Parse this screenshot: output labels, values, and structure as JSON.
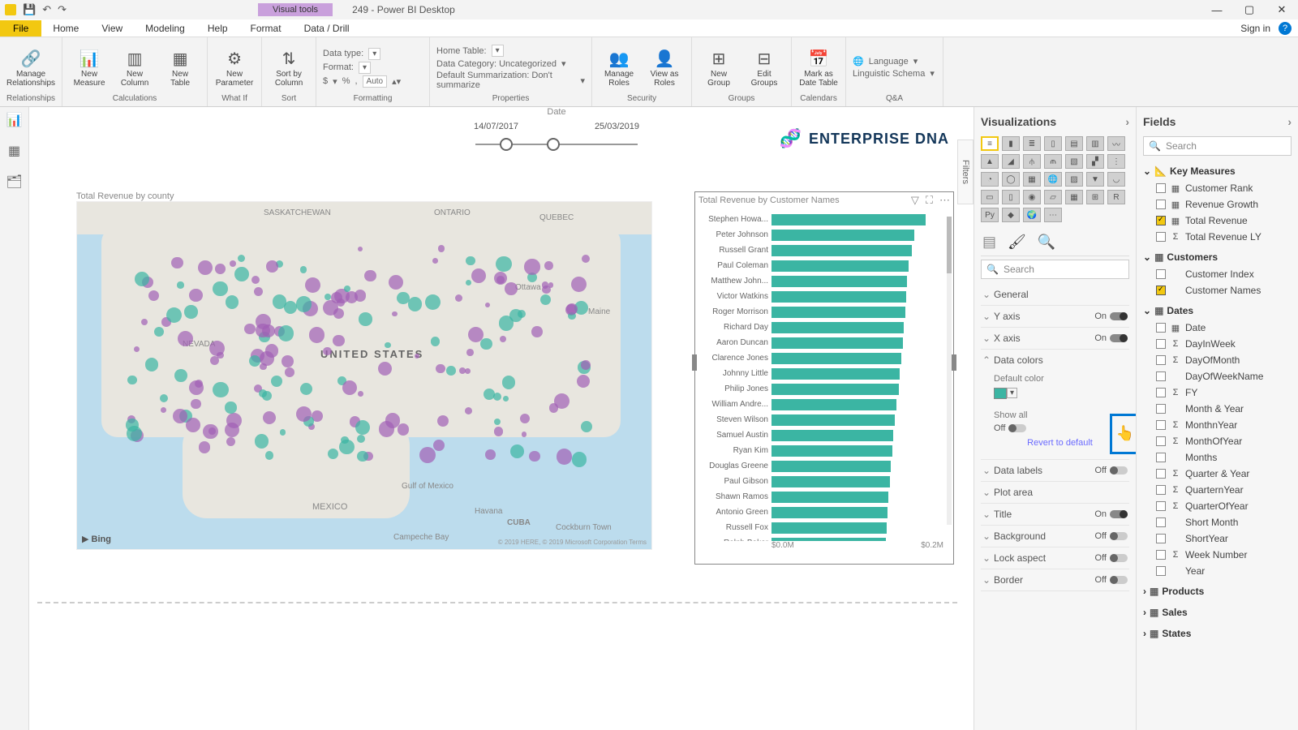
{
  "app": {
    "title": "249 - Power BI Desktop",
    "visual_tools": "Visual tools",
    "sign_in": "Sign in"
  },
  "tabs": {
    "file": "File",
    "home": "Home",
    "view": "View",
    "modeling": "Modeling",
    "help": "Help",
    "format": "Format",
    "datadrill": "Data / Drill"
  },
  "ribbon": {
    "relationships": {
      "manage": "Manage\nRelationships",
      "group": "Relationships"
    },
    "calc": {
      "measure": "New\nMeasure",
      "column": "New\nColumn",
      "table": "New\nTable",
      "group": "Calculations"
    },
    "whatif": {
      "param": "New\nParameter",
      "group": "What If"
    },
    "sort": {
      "sort": "Sort by\nColumn",
      "group": "Sort"
    },
    "formatting": {
      "datatype": "Data type:",
      "format": "Format:",
      "currency": "$",
      "percent": "%",
      "comma": ",",
      "auto": "Auto",
      "group": "Formatting"
    },
    "properties": {
      "hometable": "Home Table:",
      "datacat": "Data Category: Uncategorized",
      "defsum": "Default Summarization: Don't summarize",
      "group": "Properties"
    },
    "security": {
      "manage": "Manage\nRoles",
      "viewas": "View as\nRoles",
      "group": "Security"
    },
    "groups": {
      "new": "New\nGroup",
      "edit": "Edit\nGroups",
      "group": "Groups"
    },
    "calendars": {
      "mark": "Mark as\nDate Table",
      "group": "Calendars"
    },
    "qa": {
      "lang": "Language",
      "schema": "Linguistic Schema",
      "group": "Q&A"
    }
  },
  "canvas": {
    "date_label": "Date",
    "date_start": "14/07/2017",
    "date_end": "25/03/2019",
    "brand": "ENTERPRISE DNA",
    "map_title": "Total Revenue by county",
    "bing": "Bing",
    "map_attrib": "© 2019 HERE, © 2019 Microsoft Corporation Terms",
    "map_labels": {
      "us": "UNITED STATES",
      "saskatchewan": "SASKATCHEWAN",
      "ontario": "ONTARIO",
      "quebec": "QUEBEC",
      "mexico": "MEXICO",
      "gulf": "Gulf of Mexico",
      "cuba": "CUBA",
      "havana": "Havana",
      "ottawa": "Ottawa",
      "maine": "Maine",
      "nevada": "NEVADA",
      "campeche": "Campeche Bay",
      "cockburn": "Cockburn Town"
    },
    "bar_title": "Total Revenue by Customer Names",
    "axis_lo": "$0.0M",
    "axis_hi": "$0.2M",
    "filters": "Filters"
  },
  "chart_data": {
    "type": "bar",
    "title": "Total Revenue by Customer Names",
    "xlabel": "",
    "ylabel": "",
    "xlim": [
      0,
      0.2
    ],
    "categories": [
      "Stephen Howa...",
      "Peter Johnson",
      "Russell Grant",
      "Paul Coleman",
      "Matthew John...",
      "Victor Watkins",
      "Roger Morrison",
      "Richard Day",
      "Aaron Duncan",
      "Clarence Jones",
      "Johnny Little",
      "Philip Jones",
      "William Andre...",
      "Steven Wilson",
      "Samuel Austin",
      "Ryan Kim",
      "Douglas Greene",
      "Paul Gibson",
      "Shawn Ramos",
      "Antonio Green",
      "Russell Fox",
      "Ralph Baker"
    ],
    "values": [
      0.2,
      0.185,
      0.182,
      0.178,
      0.176,
      0.175,
      0.174,
      0.172,
      0.17,
      0.168,
      0.166,
      0.165,
      0.162,
      0.16,
      0.158,
      0.157,
      0.155,
      0.154,
      0.152,
      0.15,
      0.149,
      0.148
    ]
  },
  "viz": {
    "title": "Visualizations",
    "search": "Search",
    "sections": {
      "general": "General",
      "yaxis": "Y axis",
      "xaxis": "X axis",
      "datacolors": "Data colors",
      "default_color": "Default color",
      "show_all": "Show all",
      "revert": "Revert to default",
      "datalabels": "Data labels",
      "plotarea": "Plot area",
      "title_s": "Title",
      "background": "Background",
      "lockaspect": "Lock aspect",
      "border": "Border"
    },
    "on": "On",
    "off": "Off",
    "color": "#3bb5a3"
  },
  "fields": {
    "title": "Fields",
    "search": "Search",
    "tables": {
      "key_measures": {
        "label": "Key Measures",
        "fields": [
          {
            "label": "Customer Rank",
            "checked": false,
            "icon": "▦"
          },
          {
            "label": "Revenue Growth",
            "checked": false,
            "icon": "▦"
          },
          {
            "label": "Total Revenue",
            "checked": true,
            "icon": "▦"
          },
          {
            "label": "Total Revenue LY",
            "checked": false,
            "icon": "Σ"
          }
        ]
      },
      "customers": {
        "label": "Customers",
        "fields": [
          {
            "label": "Customer Index",
            "checked": false,
            "icon": ""
          },
          {
            "label": "Customer Names",
            "checked": true,
            "icon": ""
          }
        ]
      },
      "dates": {
        "label": "Dates",
        "fields": [
          {
            "label": "Date",
            "checked": false,
            "icon": "▦"
          },
          {
            "label": "DayInWeek",
            "checked": false,
            "icon": "Σ"
          },
          {
            "label": "DayOfMonth",
            "checked": false,
            "icon": "Σ"
          },
          {
            "label": "DayOfWeekName",
            "checked": false,
            "icon": ""
          },
          {
            "label": "FY",
            "checked": false,
            "icon": "Σ"
          },
          {
            "label": "Month & Year",
            "checked": false,
            "icon": ""
          },
          {
            "label": "MonthnYear",
            "checked": false,
            "icon": "Σ"
          },
          {
            "label": "MonthOfYear",
            "checked": false,
            "icon": "Σ"
          },
          {
            "label": "Months",
            "checked": false,
            "icon": ""
          },
          {
            "label": "Quarter & Year",
            "checked": false,
            "icon": "Σ"
          },
          {
            "label": "QuarternYear",
            "checked": false,
            "icon": "Σ"
          },
          {
            "label": "QuarterOfYear",
            "checked": false,
            "icon": "Σ"
          },
          {
            "label": "Short Month",
            "checked": false,
            "icon": ""
          },
          {
            "label": "ShortYear",
            "checked": false,
            "icon": ""
          },
          {
            "label": "Week Number",
            "checked": false,
            "icon": "Σ"
          },
          {
            "label": "Year",
            "checked": false,
            "icon": ""
          }
        ]
      },
      "products": {
        "label": "Products"
      },
      "sales": {
        "label": "Sales"
      },
      "states": {
        "label": "States"
      }
    }
  }
}
